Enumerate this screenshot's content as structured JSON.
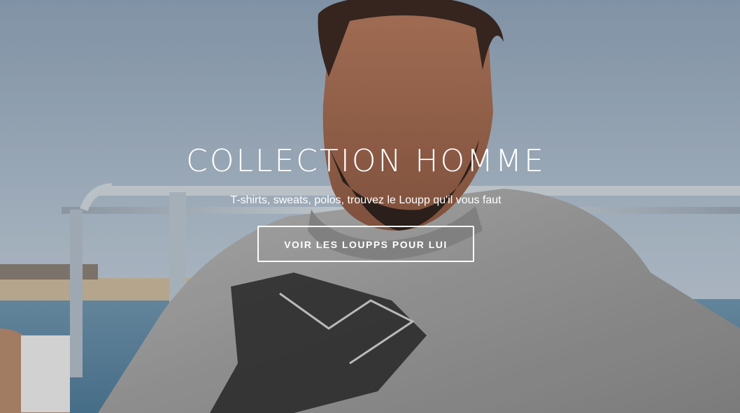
{
  "hero": {
    "title": "COLLECTION HOMME",
    "subtitle": "T-shirts, sweats, polos, trouvez le Loupp qu'il vous faut",
    "button_label": "VOIR LES LOUPPS POUR LUI"
  }
}
